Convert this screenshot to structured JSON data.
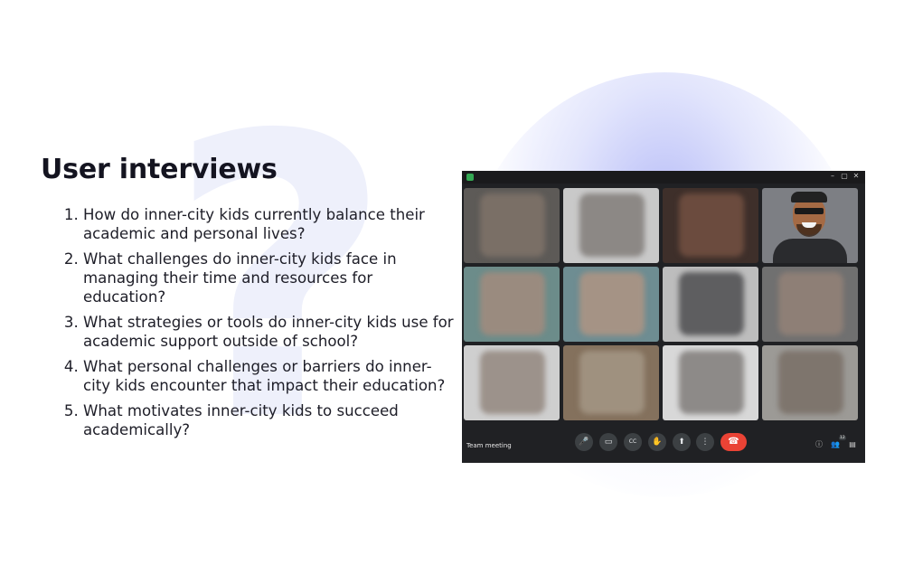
{
  "slide": {
    "title": "User interviews",
    "background_glyph": "?",
    "questions": [
      "How do inner-city kids currently balance their academic and personal lives?",
      "What challenges do inner-city kids face in managing their time and resources for education?",
      "What strategies or tools do inner-city kids use for academic support outside of school?",
      "What personal challenges or barriers do inner-city kids encounter that impact their education?",
      "What motivates inner-city kids to succeed academically?"
    ]
  },
  "meeting": {
    "label": "Team meeting",
    "participants_count": "12",
    "controls": [
      {
        "name": "microphone-icon",
        "glyph": "🎤"
      },
      {
        "name": "camera-icon",
        "glyph": "▭"
      },
      {
        "name": "captions-icon",
        "glyph": "CC"
      },
      {
        "name": "raise-hand-icon",
        "glyph": "✋"
      },
      {
        "name": "present-screen-icon",
        "glyph": "⬆"
      },
      {
        "name": "more-options-icon",
        "glyph": "⋮"
      },
      {
        "name": "end-call-icon",
        "glyph": "☎"
      }
    ],
    "right_icons": [
      "info-icon",
      "people-icon",
      "chat-icon"
    ],
    "window_buttons": [
      "–",
      "▢",
      "✕"
    ],
    "colors": {
      "background": "#202124",
      "control": "#3c4043",
      "end_call": "#ea4335",
      "glow": "#8c96f0"
    }
  }
}
